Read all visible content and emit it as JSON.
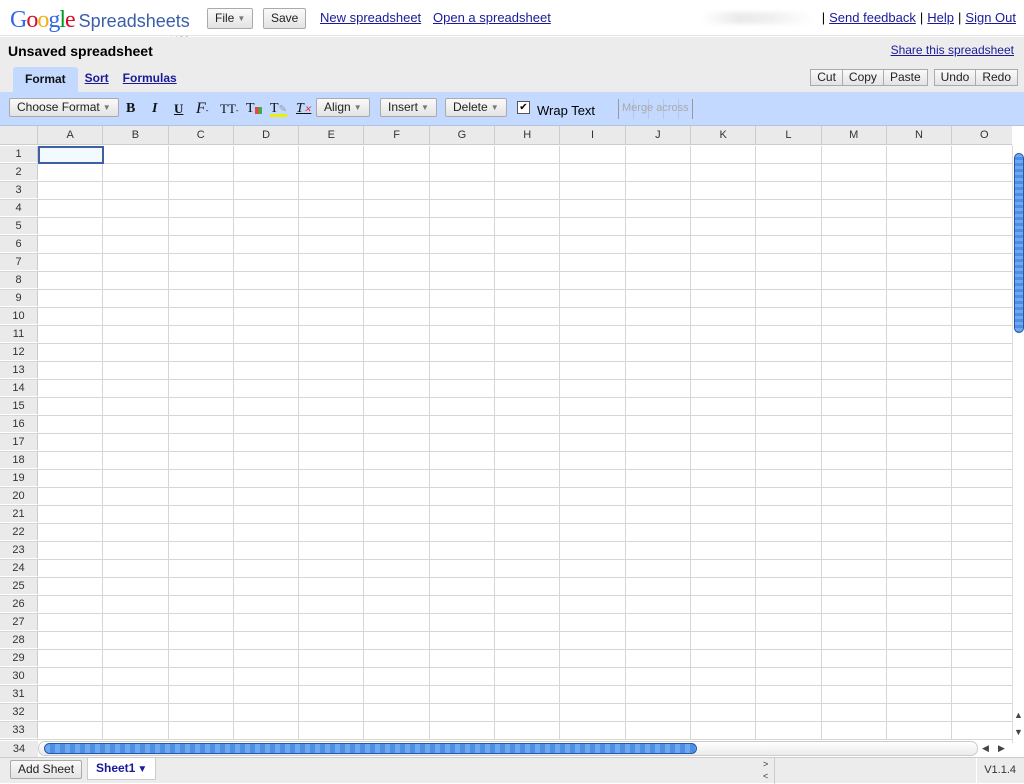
{
  "app": {
    "logo_brand": [
      "G",
      "o",
      "o",
      "g",
      "l",
      "e"
    ],
    "logo_product": "Spreadsheets",
    "logo_labs": "LABS"
  },
  "topbar": {
    "file_label": "File",
    "save_label": "Save",
    "new_link": "New spreadsheet",
    "open_link": "Open a spreadsheet",
    "separator": "|",
    "send_feedback": "Send feedback",
    "help": "Help",
    "sign_out": "Sign Out"
  },
  "titlebar": {
    "doc_title": "Unsaved spreadsheet",
    "share_link": "Share this spreadsheet",
    "tabs": [
      {
        "label": "Format",
        "active": true
      },
      {
        "label": "Sort",
        "active": false
      },
      {
        "label": "Formulas",
        "active": false
      }
    ],
    "edit_buttons": {
      "cut": "Cut",
      "copy": "Copy",
      "paste": "Paste",
      "undo": "Undo",
      "redo": "Redo"
    }
  },
  "toolbar": {
    "choose_format": "Choose Format",
    "bold": "B",
    "italic": "I",
    "underline": "U",
    "font_icon": "F",
    "size_icon": "TT",
    "text_color_icon": "T",
    "highlight_icon": "T",
    "clear_format_icon": "T",
    "align": "Align",
    "insert": "Insert",
    "delete": "Delete",
    "wrap_text_label": "Wrap Text",
    "wrap_text_checked": true,
    "merge_across": "Merge across"
  },
  "grid": {
    "columns": [
      "A",
      "B",
      "C",
      "D",
      "E",
      "F",
      "G",
      "H",
      "I",
      "J",
      "K",
      "L",
      "M",
      "N",
      "O"
    ],
    "rows": [
      "1",
      "2",
      "3",
      "4",
      "5",
      "6",
      "7",
      "8",
      "9",
      "10",
      "11",
      "12",
      "13",
      "14",
      "15",
      "16",
      "17",
      "18",
      "19",
      "20",
      "21",
      "22",
      "23",
      "24",
      "25",
      "26",
      "27",
      "28",
      "29",
      "30",
      "31",
      "32",
      "33"
    ],
    "last_row_label": "34",
    "selected_cell": "A1"
  },
  "scroll": {
    "up": "▲",
    "down": "▼",
    "left": "◀",
    "right": "▶"
  },
  "bottombar": {
    "add_sheet": "Add Sheet",
    "sheet_tab": "Sheet1",
    "nav_next": ">",
    "nav_prev": "<",
    "version": "V1.1.4"
  },
  "colors": {
    "accent_blue": "#c3d9ff",
    "link": "#1a1a99",
    "selection": "#3d5fa3"
  }
}
